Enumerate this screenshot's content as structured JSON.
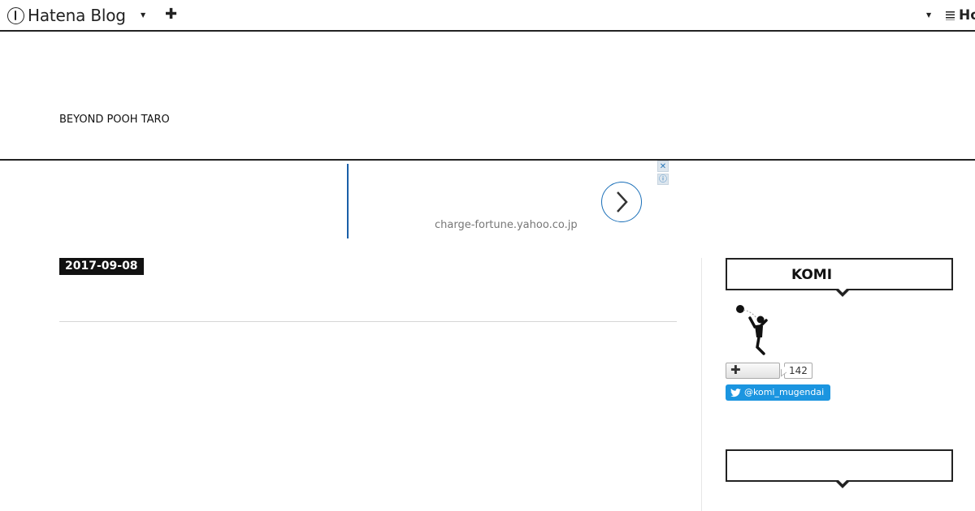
{
  "topbar": {
    "brand": "Hatena Blog",
    "right_brand": "Ho"
  },
  "blog": {
    "title": "BEYOND POOH TARO"
  },
  "ad": {
    "url": "charge-fortune.yahoo.co.jp",
    "close_glyph": "✕",
    "info_glyph": "ⓘ"
  },
  "entry": {
    "date": "2017-09-08"
  },
  "sidebar": {
    "profile": {
      "heading": "KOMI",
      "subscribe_glyph": "✚",
      "subscribe_count": "142",
      "twitter_handle": "@komi_mugendai"
    },
    "second_widget": {
      "heading": ""
    }
  },
  "colors": {
    "accent_blue": "#1a5fa8",
    "twitter_blue": "#1b95e0",
    "date_badge_bg": "#111111"
  }
}
